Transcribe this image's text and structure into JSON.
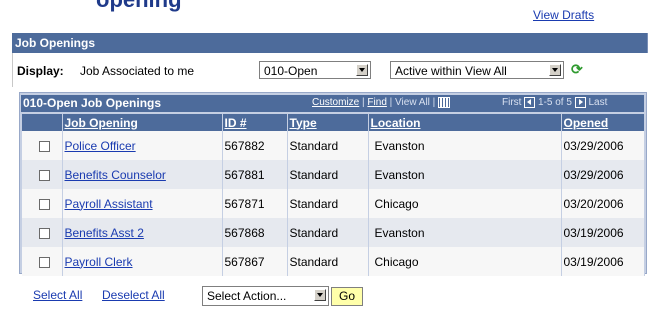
{
  "page": {
    "title_fragment": "opening",
    "view_drafts": "View Drafts"
  },
  "section": {
    "title": "Job Openings"
  },
  "display": {
    "label": "Display:",
    "value": "Job Associated to me",
    "status_select": "010-Open",
    "scope_select": "Active within View All"
  },
  "grid": {
    "title": "010-Open Job Openings",
    "nav": {
      "customize": "Customize",
      "sep1": "|",
      "find": "Find",
      "sep2": "|",
      "view_all": "View All",
      "sep3": "|"
    },
    "paging": {
      "first": "First",
      "range": "1-5 of 5",
      "last": "Last"
    },
    "columns": [
      "Job Opening",
      "ID #",
      "Type",
      "Location",
      "Opened"
    ],
    "rows": [
      {
        "title": "Police Officer",
        "id": "567882",
        "type": "Standard",
        "location": "Evanston",
        "opened": "03/29/2006"
      },
      {
        "title": "Benefits Counselor",
        "id": "567881",
        "type": "Standard",
        "location": "Evanston",
        "opened": "03/29/2006"
      },
      {
        "title": "Payroll Assistant",
        "id": "567871",
        "type": "Standard",
        "location": "Chicago",
        "opened": "03/20/2006"
      },
      {
        "title": "Benefits Asst 2",
        "id": "567868",
        "type": "Standard",
        "location": "Evanston",
        "opened": "03/19/2006"
      },
      {
        "title": "Payroll Clerk",
        "id": "567867",
        "type": "Standard",
        "location": "Chicago",
        "opened": "03/19/2006"
      }
    ]
  },
  "footer": {
    "select_all": "Select All",
    "deselect_all": "Deselect All",
    "action_select": "Select Action...",
    "go": "Go"
  }
}
